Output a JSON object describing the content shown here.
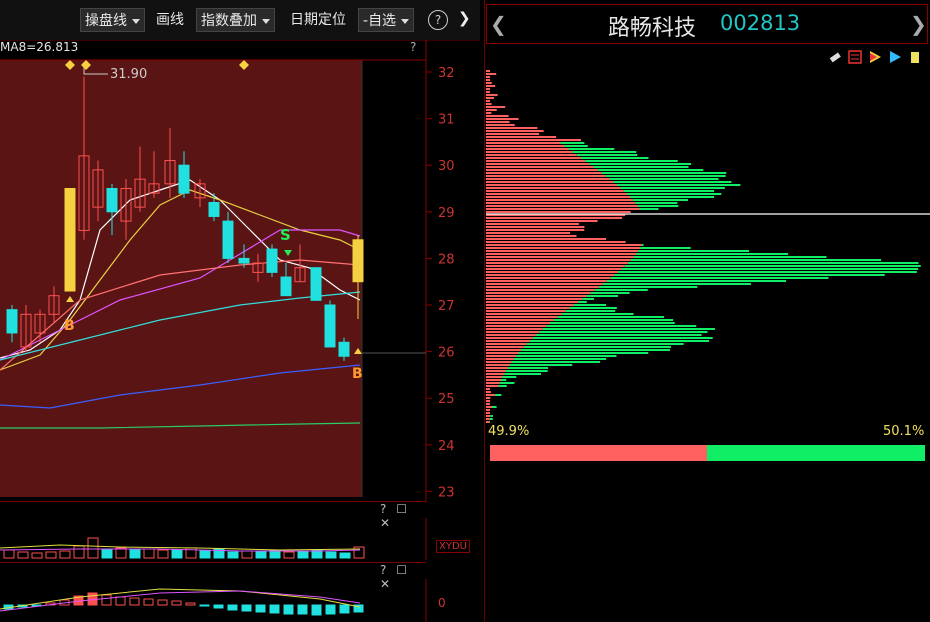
{
  "toolbar": {
    "operate_line": "操盘线",
    "draw_line": "画线",
    "index_overlay": "指数叠加",
    "date_locate": "日期定位",
    "self_select": "自选",
    "minus": "-"
  },
  "kline": {
    "ma_label": "MA8=26.813",
    "question": "?",
    "high_marker": "31.90",
    "price_ticks": [
      "32",
      "31",
      "30",
      "29",
      "28",
      "27",
      "26",
      "25",
      "24",
      "23"
    ],
    "signal_s": "S",
    "signal_b1": "B",
    "signal_b2": "B"
  },
  "volume_panel": {
    "tag": "XYDU",
    "controls": "?"
  },
  "macd_panel": {
    "zero_label": "0",
    "controls": "?"
  },
  "chip_panel": {
    "stock_name": "路畅科技",
    "stock_code": "002813",
    "prev_icon": "chevron-left-icon",
    "next_icon": "chevron-right-icon",
    "profit_ratio_label": "49.9%",
    "loss_ratio_label": "50.1%",
    "profit_ratio": 0.499,
    "colors": {
      "profit": "#ff6060",
      "loss": "#10ee66",
      "cost_line": "#ffffff"
    }
  }
}
